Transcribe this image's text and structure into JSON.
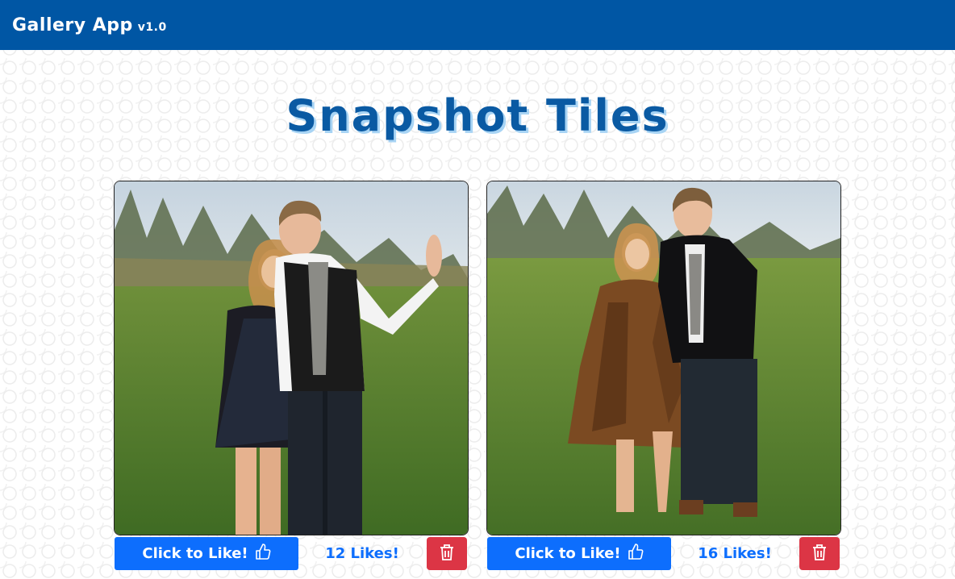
{
  "navbar": {
    "brand": "Gallery App",
    "version": "v1.0"
  },
  "page_title": "Snapshot Tiles",
  "colors": {
    "navbar": "#0056a4",
    "primary": "#0d6efd",
    "danger": "#dc3545",
    "title": "#0a5aa3",
    "title_shadow": "#a8d4f4"
  },
  "tiles": [
    {
      "like_label": "Click to Like!",
      "likes_text": "12 Likes!",
      "like_icon": "thumbs-up-icon",
      "delete_icon": "trash-icon"
    },
    {
      "like_label": "Click to Like!",
      "likes_text": "16 Likes!",
      "like_icon": "thumbs-up-icon",
      "delete_icon": "trash-icon"
    }
  ]
}
